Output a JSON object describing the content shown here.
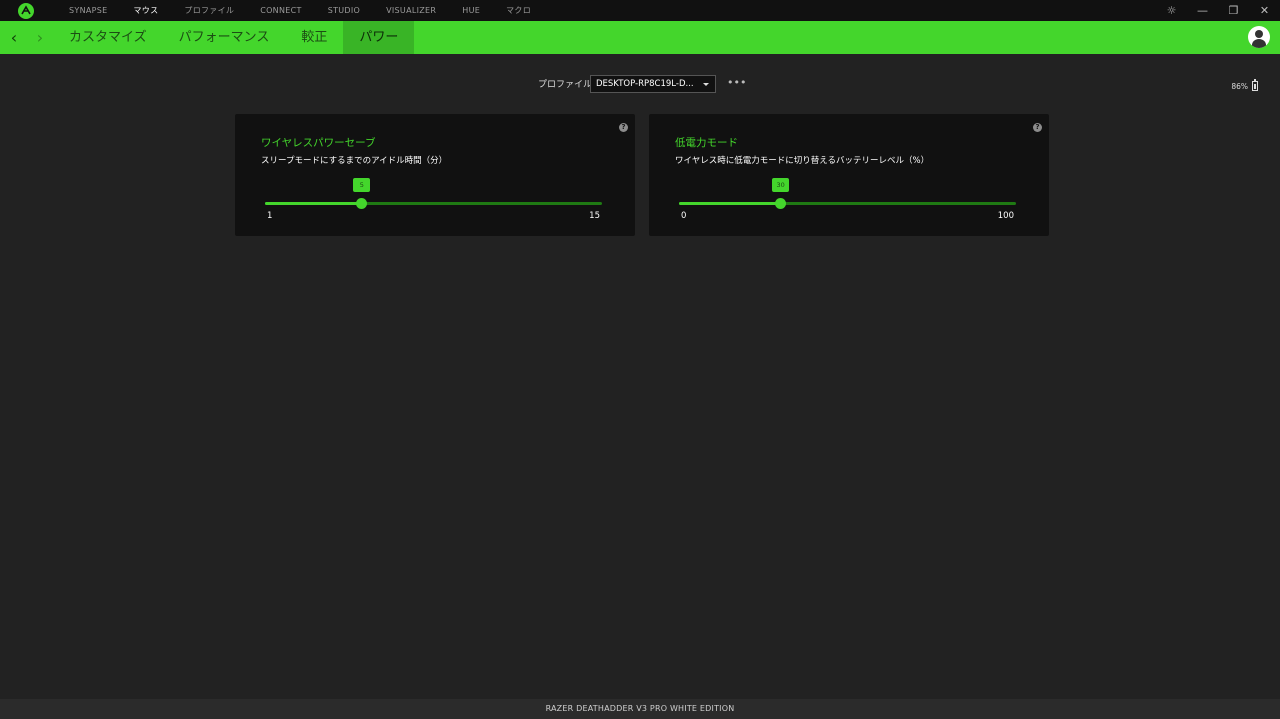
{
  "topnav": {
    "items": [
      "SYNAPSE",
      "マウス",
      "プロファイル",
      "CONNECT",
      "STUDIO",
      "VISUALIZER",
      "HUE",
      "マクロ"
    ],
    "active_index": 1
  },
  "window_controls": {
    "settings": "☼",
    "minimize": "—",
    "restore": "❐",
    "close": "✕"
  },
  "nav": {
    "back": "‹",
    "forward": "›"
  },
  "subtabs": [
    "カスタマイズ",
    "パフォーマンス",
    "較正",
    "パワー"
  ],
  "subtab_active_index": 3,
  "profile": {
    "label": "プロファイル",
    "value": "DESKTOP-RP8C19L-D...",
    "more": "•••"
  },
  "battery": {
    "text": "86%",
    "level": 0.86
  },
  "cards": {
    "wireless_power_save": {
      "title": "ワイヤレスパワーセーブ",
      "description": "スリープモードにするまでのアイドル時間（分）",
      "help": "?",
      "min": "1",
      "max": "15",
      "value": "5",
      "value_num": 5,
      "min_num": 1,
      "max_num": 15
    },
    "low_power_mode": {
      "title": "低電力モード",
      "description": "ワイヤレス時に低電力モードに切り替えるバッテリーレベル（%）",
      "help": "?",
      "min": "0",
      "max": "100",
      "value": "30",
      "value_num": 30,
      "min_num": 0,
      "max_num": 100
    }
  },
  "footer": {
    "device_name": "RAZER DEATHADDER V3 PRO WHITE EDITION"
  },
  "colors": {
    "accent": "#44d62c",
    "background": "#222222",
    "card": "#111111",
    "topbar": "#111111"
  }
}
